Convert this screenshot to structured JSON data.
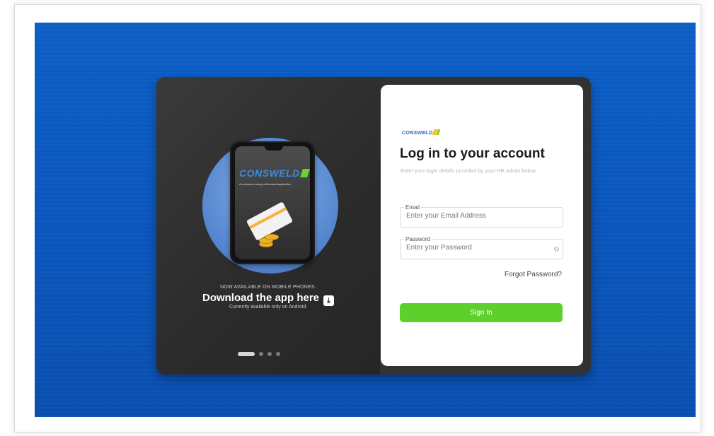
{
  "colors": {
    "background": "#0b57bf",
    "card_dark": "#323232",
    "primary_button": "#5ed02c",
    "brand_blue": "#1f5fbf"
  },
  "promo": {
    "brand": "CONSWELD",
    "tagline": "An advance salary withdrawal application",
    "availability": "NOW AVAILABLE ON MOBILE PHONES.",
    "headline": "Download the app here",
    "note": "Currently available only on Android.",
    "download_icon": "download-icon",
    "carousel": {
      "total": 4,
      "active": 1
    }
  },
  "login": {
    "logo": "CONSWELD",
    "title": "Log in to your account",
    "subtitle": "Enter your login details provided by your HR admin below.",
    "email": {
      "label": "Email",
      "value": "",
      "placeholder": "Enter your Email Address"
    },
    "password": {
      "label": "Password",
      "value": "",
      "placeholder": "Enter your Password",
      "toggle_icon": "eye-off-icon"
    },
    "forgot_label": "Forgot Password?",
    "submit_label": "Sign In"
  }
}
